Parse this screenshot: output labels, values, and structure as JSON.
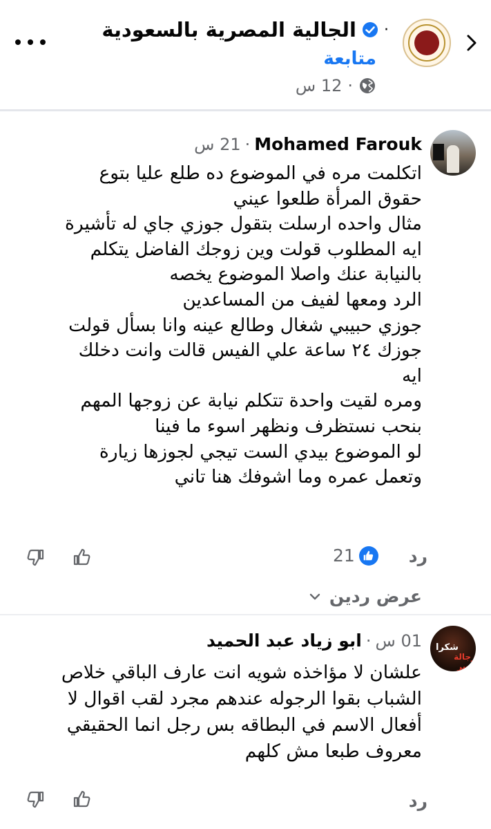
{
  "header": {
    "page_name": "الجالية المصرية بالسعودية",
    "dot": "·",
    "follow": "متابعة",
    "time": "12 س",
    "meta_dot": "·"
  },
  "comments": [
    {
      "author": "Mohamed Farouk",
      "time": "21 س",
      "dot": "·",
      "lines": [
        "اتكلمت مره في الموضوع ده طلع عليا بتوع",
        "حقوق المرأة طلعوا عيني",
        "مثال واحده ارسلت بتقول جوزي جاي له تأشيرة",
        "ايه المطلوب قولت وين زوجك الفاضل يتكلم",
        "بالنيابة عنك واصلا الموضوع يخصه",
        "الرد ومعها لفيف من المساعدين",
        "جوزي حبيبي شغال وطالع عينه وانا بسأل قولت",
        "جوزك ٢٤ ساعة علي الفيس قالت وانت دخلك",
        "ايه",
        "ومره لقيت واحدة تتكلم نيابة عن زوجها  المهم",
        "بنحب نستظرف ونظهر اسوء ما فينا",
        "لو الموضوع بيدي الست تيجي لجوزها زيارة",
        "وتعمل عمره وما اشوفك هنا تاني"
      ],
      "reply_label": "رد",
      "like_count": "21",
      "view_replies": "عرض ردين"
    },
    {
      "author": "ابو زياد عبد الحميد",
      "time": "01 س",
      "dot": "·",
      "avatar_text_top": "شكرا",
      "avatar_text_bottom": "رجالة مصر",
      "lines": [
        "علشان لا مؤاخذه شويه انت عارف الباقي خلاص",
        "الشباب بقوا الرجوله عندهم مجرد لقب اقوال لا",
        "أفعال الاسم في البطاقه بس رجل انما الحقيقي",
        "معروف طبعا مش كلهم"
      ],
      "reply_label": "رد"
    }
  ],
  "colors": {
    "accent": "#1877f2",
    "secondary_text": "#65676b",
    "divider": "#e4e6eb"
  }
}
